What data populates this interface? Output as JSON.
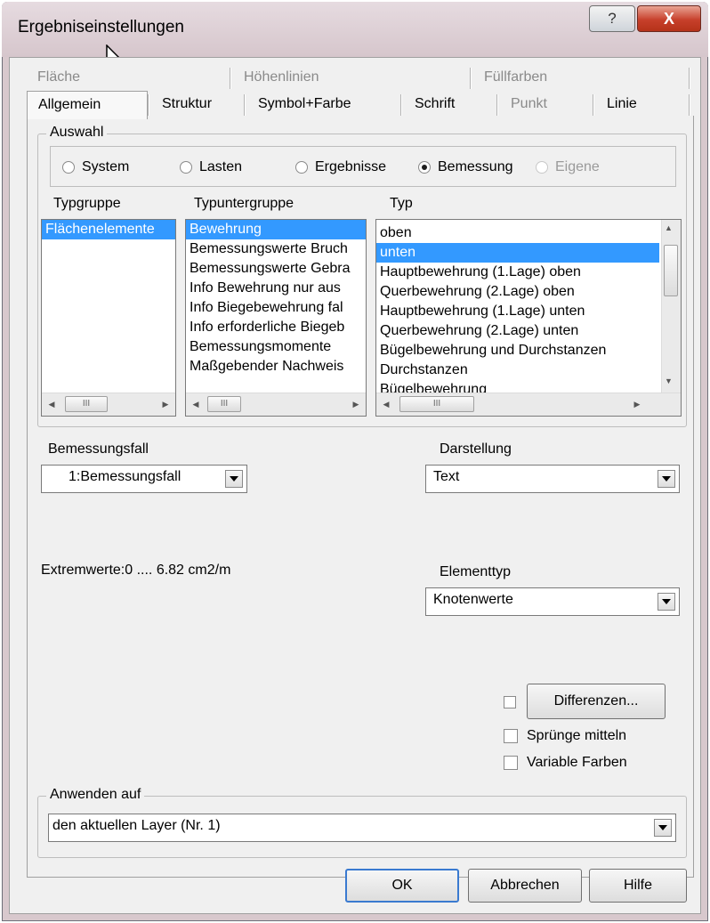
{
  "window": {
    "title": "Ergebniseinstellungen",
    "help_glyph": "?",
    "close_glyph": "X"
  },
  "tabs": {
    "row1": [
      "Fläche",
      "Höhenlinien",
      "Füllfarben"
    ],
    "row2": [
      "Allgemein",
      "Struktur",
      "Symbol+Farbe",
      "Schrift",
      "Punkt",
      "Linie"
    ]
  },
  "auswahl": {
    "legend": "Auswahl",
    "options": [
      "System",
      "Lasten",
      "Ergebnisse",
      "Bemessung",
      "Eigene"
    ],
    "selected": "Bemessung"
  },
  "lists": {
    "typgruppe": {
      "header": "Typgruppe",
      "items": [
        "Flächenelemente"
      ]
    },
    "typuntergruppe": {
      "header": "Typuntergruppe",
      "items": [
        "Bewehrung",
        "Bemessungswerte Bruch",
        "Bemessungswerte Gebra",
        "Info Bewehrung nur aus",
        "Info Biegebewehrung fal",
        "Info erforderliche Biegeb",
        "Bemessungsmomente",
        "Maßgebender Nachweis"
      ]
    },
    "typ": {
      "header": "Typ",
      "items": [
        "oben",
        "unten",
        "Hauptbewehrung (1.Lage) oben",
        "Querbewehrung (2.Lage) oben",
        "Hauptbewehrung (1.Lage) unten",
        "Querbewehrung (2.Lage) unten",
        "Bügelbewehrung und Durchstanzen",
        "Durchstanzen",
        "Bügelbewehrung"
      ]
    },
    "scroll_thumb_glyph": "III"
  },
  "bemessungsfall": {
    "label": "Bemessungsfall",
    "value": "1:Bemessungsfall"
  },
  "darstellung": {
    "label": "Darstellung",
    "value": "Text"
  },
  "extremwerte": "Extremwerte:0 .... 6.82  cm2/m",
  "elementtyp": {
    "label": "Elementtyp",
    "value": "Knotenwerte"
  },
  "options": {
    "differenzen_button": "Differenzen...",
    "spruenge": "Sprünge mitteln",
    "variable_farben": "Variable Farben"
  },
  "anwenden": {
    "legend": "Anwenden auf",
    "value": "den aktuellen Layer (Nr.  1)"
  },
  "buttons": {
    "ok": "OK",
    "cancel": "Abbrechen",
    "help": "Hilfe"
  }
}
